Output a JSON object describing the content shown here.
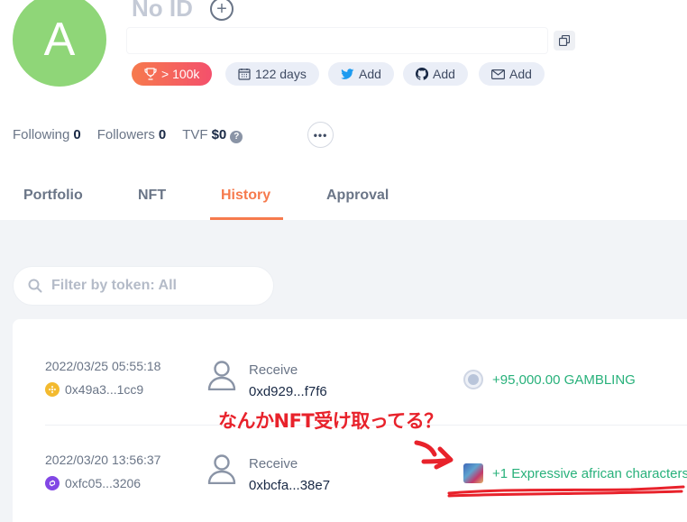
{
  "profile": {
    "avatar_letter": "A",
    "name": "No ID",
    "address_value": "",
    "badges": [
      {
        "icon": "trophy-icon",
        "label": "> 100k"
      },
      {
        "icon": "calendar-icon",
        "label": "122 days"
      },
      {
        "icon": "twitter-icon",
        "label": "Add"
      },
      {
        "icon": "github-icon",
        "label": "Add"
      },
      {
        "icon": "mail-icon",
        "label": "Add"
      }
    ]
  },
  "stats": {
    "following_label": "Following",
    "following_value": "0",
    "followers_label": "Followers",
    "followers_value": "0",
    "tvf_label": "TVF",
    "tvf_value": "$0"
  },
  "tabs": [
    {
      "label": "Portfolio",
      "active": false
    },
    {
      "label": "NFT",
      "active": false
    },
    {
      "label": "History",
      "active": true
    },
    {
      "label": "Approval",
      "active": false
    }
  ],
  "search": {
    "placeholder": "Filter by token: All"
  },
  "history": [
    {
      "time": "2022/03/25 05:55:18",
      "chain_icon": "bnb-chain-icon",
      "hash": "0x49a3...1cc9",
      "type": "Receive",
      "counterparty": "0xd929...f7f6",
      "amount": "+95,000.00 GAMBLING"
    },
    {
      "time": "2022/03/20 13:56:37",
      "chain_icon": "polygon-chain-icon",
      "hash": "0xfc05...3206",
      "type": "Receive",
      "counterparty": "0xbcfa...38e7",
      "amount": "+1 Expressive african characters"
    }
  ],
  "annotation": {
    "text": "なんかNFT受け取ってる？"
  },
  "colors": {
    "accent": "#f67a4d",
    "positive": "#28b17b",
    "annotation_red": "#e8222b",
    "avatar_green": "#8fd678"
  }
}
